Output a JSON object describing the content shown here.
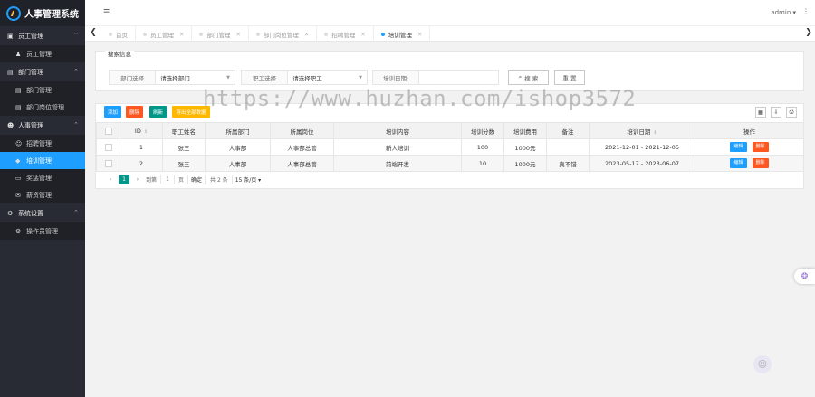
{
  "app": {
    "title": "人事管理系统",
    "logo_text": "HN"
  },
  "header": {
    "menu_icon": "hamburger-icon",
    "user": "admin ▾",
    "more_icon": "⋮"
  },
  "sidebar": {
    "groups": [
      {
        "label": "员工管理",
        "icon": "user-card-icon",
        "items": [
          {
            "label": "员工管理",
            "icon": "person-icon"
          }
        ]
      },
      {
        "label": "部门管理",
        "icon": "id-card-icon",
        "items": [
          {
            "label": "部门管理",
            "icon": "id-card-icon"
          },
          {
            "label": "部门岗位管理",
            "icon": "id-card-icon"
          }
        ]
      },
      {
        "label": "人事管理",
        "icon": "users-icon",
        "items": [
          {
            "label": "招聘管理",
            "icon": "user-add-icon"
          },
          {
            "label": "培训管理",
            "icon": "graduation-cap-icon",
            "active": true
          },
          {
            "label": "奖惩管理",
            "icon": "monitor-icon"
          },
          {
            "label": "薪资管理",
            "icon": "envelope-icon"
          }
        ]
      },
      {
        "label": "系统设置",
        "icon": "gears-icon",
        "items": [
          {
            "label": "操作员管理",
            "icon": "gears-icon"
          }
        ]
      }
    ]
  },
  "tabs": [
    {
      "label": "首页",
      "closable": false
    },
    {
      "label": "员工管理",
      "closable": true
    },
    {
      "label": "部门管理",
      "closable": true
    },
    {
      "label": "部门岗位管理",
      "closable": true
    },
    {
      "label": "招聘管理",
      "closable": true
    },
    {
      "label": "培训管理",
      "closable": true,
      "active": true
    }
  ],
  "search": {
    "legend": "搜索信息",
    "dept_label": "部门选择",
    "dept_value": "请选择部门",
    "emp_label": "职工选择",
    "emp_value": "请选择职工",
    "date_label": "培训日期:",
    "date_value": "",
    "search_btn": "搜 索",
    "reset_btn": "重 置"
  },
  "toolbar": {
    "add": "添加",
    "delete": "删除",
    "refresh": "刷新",
    "export": "导出全部数据"
  },
  "table": {
    "headers": {
      "id": "ID",
      "name": "职工姓名",
      "dept": "所属部门",
      "post": "所属岗位",
      "content": "培训内容",
      "score": "培训分数",
      "fee": "培训费用",
      "remark": "备注",
      "date": "培训日期",
      "ops": "操作"
    },
    "rows": [
      {
        "id": "1",
        "name": "张三",
        "dept": "人事部",
        "post": "人事部总管",
        "content": "新人培训",
        "score": "100",
        "fee": "1000元",
        "remark": "",
        "date": "2021-12-01 - 2021-12-05"
      },
      {
        "id": "2",
        "name": "张三",
        "dept": "人事部",
        "post": "人事部总管",
        "content": "前端开发",
        "score": "10",
        "fee": "1000元",
        "remark": "真不错",
        "date": "2023-05-17 - 2023-06-07"
      }
    ],
    "edit": "编辑",
    "del": "删除"
  },
  "pager": {
    "prev": "‹",
    "current": "1",
    "next": "›",
    "goto": "到第",
    "page_input": "1",
    "page_unit": "页",
    "confirm": "确定",
    "total": "共 2 条",
    "size": "15 条/页 ▾"
  },
  "watermark": "https://www.huzhan.com/ishop3572",
  "colors": {
    "sidebar": "#282b33",
    "active": "#1e9fff",
    "add": "#1e9fff",
    "delete": "#ff5722",
    "refresh": "#009688",
    "export": "#ffb800"
  }
}
